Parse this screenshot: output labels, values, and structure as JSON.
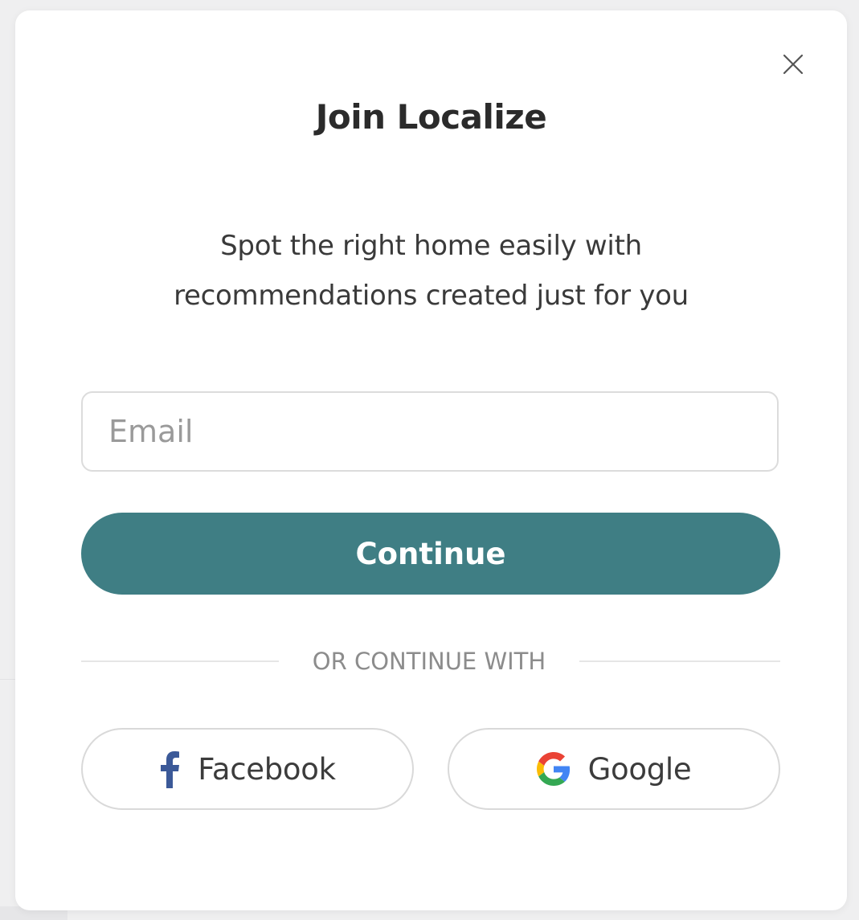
{
  "modal": {
    "title": "Join Localize",
    "subtitle_line1": "Spot the right home easily with",
    "subtitle_line2": "recommendations created just for you",
    "close_icon": "close-icon"
  },
  "form": {
    "email_placeholder": "Email",
    "email_value": "",
    "continue_label": "Continue"
  },
  "divider": {
    "text": "OR CONTINUE WITH"
  },
  "social": {
    "facebook_label": "Facebook",
    "facebook_icon": "facebook-icon",
    "google_label": "Google",
    "google_icon": "google-icon"
  },
  "colors": {
    "primary": "#3f7e84",
    "facebook_blue": "#3b5998",
    "google_blue": "#4285F4",
    "google_red": "#EA4335",
    "google_yellow": "#FBBC05",
    "google_green": "#34A853"
  }
}
